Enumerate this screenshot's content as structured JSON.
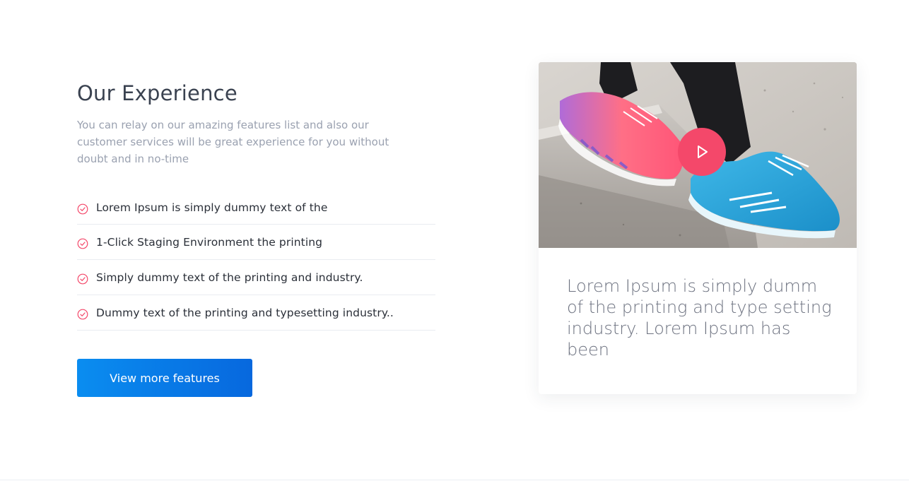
{
  "experience": {
    "title": "Our Experience",
    "lead": "You can relay on our amazing features list and also our customer services will be great experience for you without doubt and in no-time",
    "features": [
      {
        "label": "Lorem Ipsum is simply dummy text of the",
        "icon": "check-circle-icon"
      },
      {
        "label": "1-Click Staging Environment the printing",
        "icon": "check-circle-icon"
      },
      {
        "label": "Simply dummy text of the printing and industry.",
        "icon": "check-circle-icon"
      },
      {
        "label": "Dummy text of the printing and typesetting industry..",
        "icon": "check-circle-icon"
      }
    ],
    "cta_label": "View more features"
  },
  "card": {
    "image": "sneakers-photo",
    "play_icon": "play-icon",
    "text": "Lorem Ipsum is simply dumm of the printing and type setting industry. Lorem Ipsum has been"
  },
  "colors": {
    "accent": "#f4486a",
    "button_start": "#0a8df0",
    "button_end": "#0768de",
    "title": "#3a4250",
    "muted": "#9aa1b0"
  }
}
